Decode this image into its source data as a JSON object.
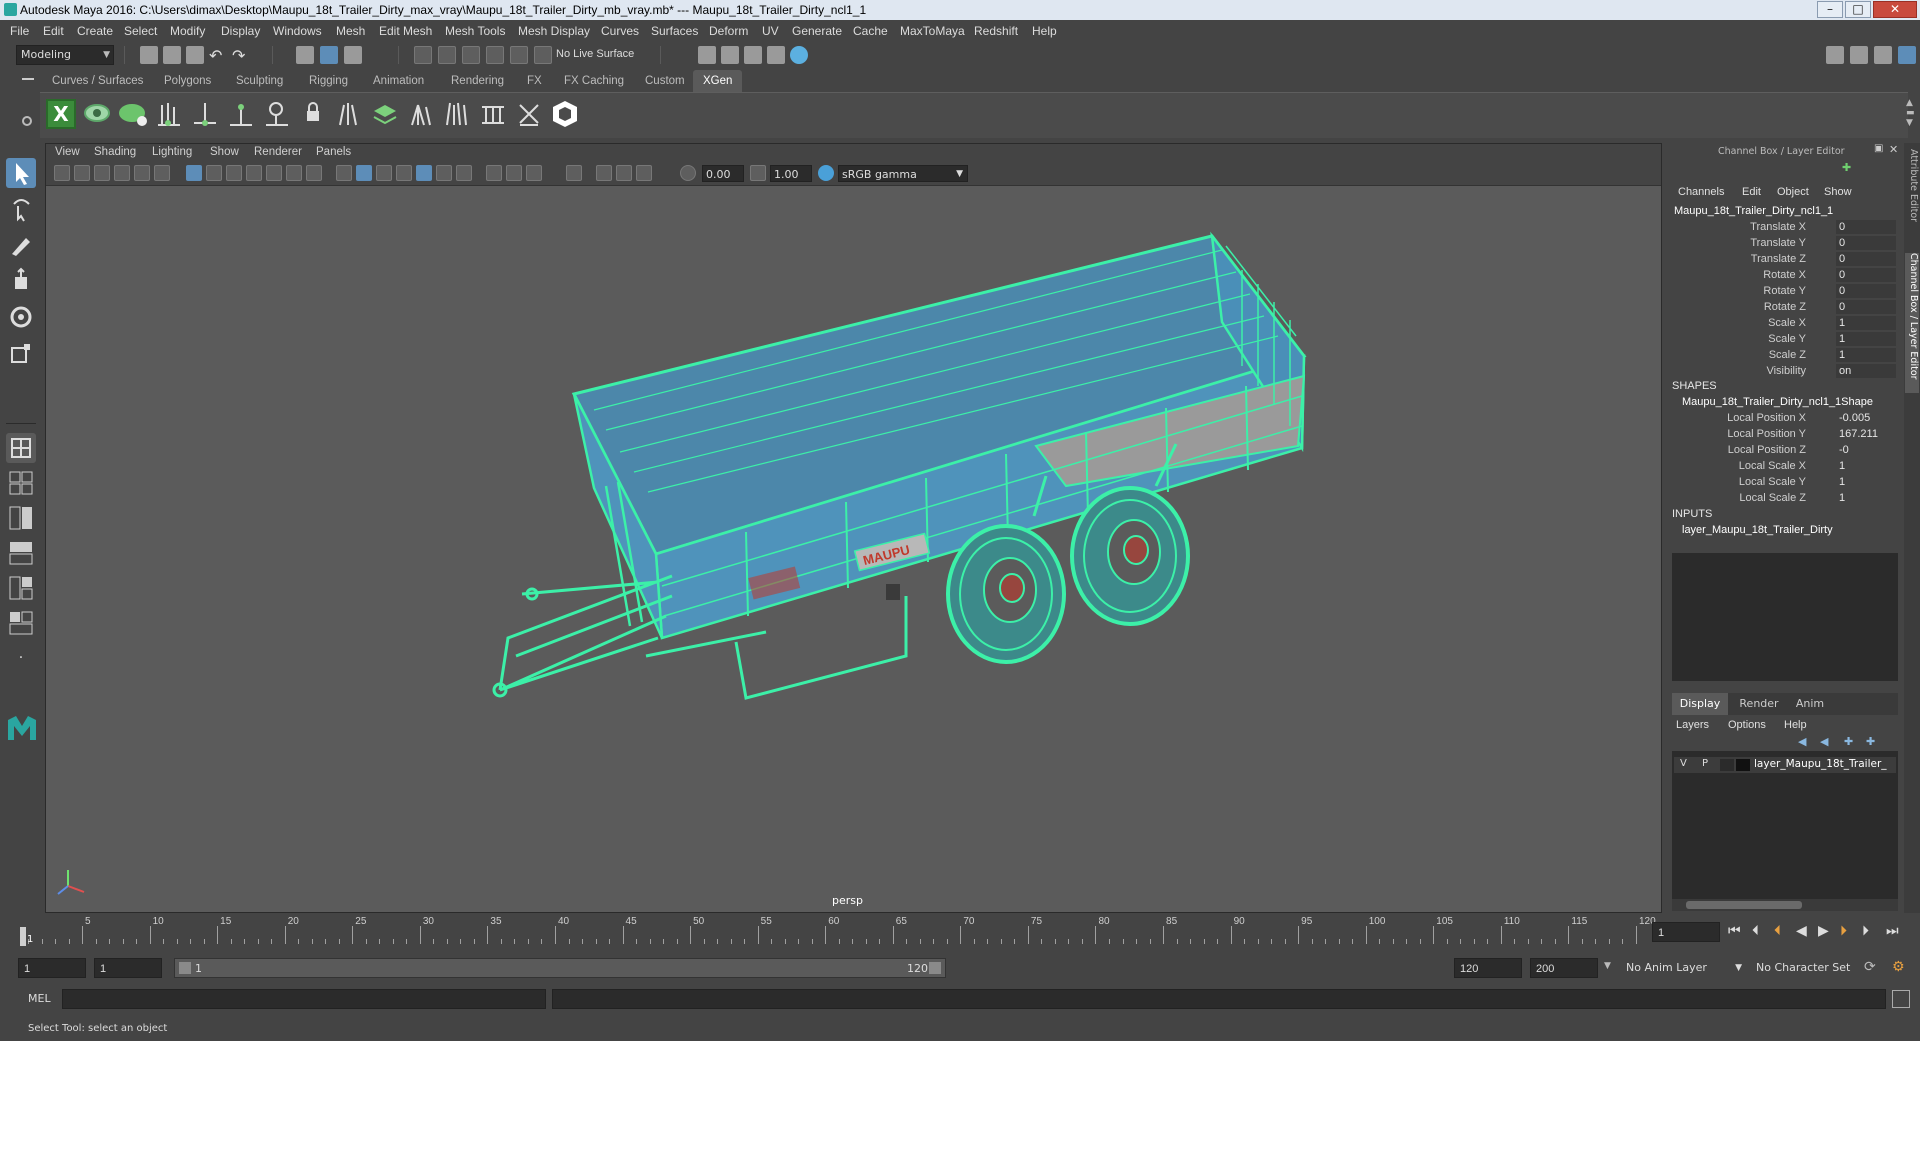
{
  "window": {
    "title": "Autodesk Maya 2016: C:\\Users\\dimax\\Desktop\\Maupu_18t_Trailer_Dirty_max_vray\\Maupu_18t_Trailer_Dirty_mb_vray.mb*   ---   Maupu_18t_Trailer_Dirty_ncl1_1",
    "minimize": "–",
    "maximize": "□",
    "close": "✕"
  },
  "menu": [
    "File",
    "Edit",
    "Create",
    "Select",
    "Modify",
    "Display",
    "Windows",
    "Mesh",
    "Edit Mesh",
    "Mesh Tools",
    "Mesh Display",
    "Curves",
    "Surfaces",
    "Deform",
    "UV",
    "Generate",
    "Cache",
    "MaxToMaya",
    "Redshift",
    "Help"
  ],
  "statusline": {
    "mode": "Modeling",
    "live_surface": "No Live Surface"
  },
  "shelf_tabs": [
    "Curves / Surfaces",
    "Polygons",
    "Sculpting",
    "Rigging",
    "Animation",
    "Rendering",
    "FX",
    "FX Caching",
    "Custom",
    "XGen"
  ],
  "shelf_active": "XGen",
  "viewport": {
    "menu": [
      "View",
      "Shading",
      "Lighting",
      "Show",
      "Renderer",
      "Panels"
    ],
    "exposure": "0.00",
    "gamma": "1.00",
    "color_space": "sRGB gamma",
    "camera": "persp",
    "brand_text": "MAUPU"
  },
  "channel_box": {
    "title": "Channel Box / Layer Editor",
    "menu": [
      "Channels",
      "Edit",
      "Object",
      "Show"
    ],
    "object_name": "Maupu_18t_Trailer_Dirty_ncl1_1",
    "channels": [
      {
        "label": "Translate X",
        "value": "0"
      },
      {
        "label": "Translate Y",
        "value": "0"
      },
      {
        "label": "Translate Z",
        "value": "0"
      },
      {
        "label": "Rotate X",
        "value": "0"
      },
      {
        "label": "Rotate Y",
        "value": "0"
      },
      {
        "label": "Rotate Z",
        "value": "0"
      },
      {
        "label": "Scale X",
        "value": "1"
      },
      {
        "label": "Scale Y",
        "value": "1"
      },
      {
        "label": "Scale Z",
        "value": "1"
      },
      {
        "label": "Visibility",
        "value": "on"
      }
    ],
    "shapes_header": "SHAPES",
    "shape_name": "Maupu_18t_Trailer_Dirty_ncl1_1Shape",
    "shape_channels": [
      {
        "label": "Local Position X",
        "value": "-0.005"
      },
      {
        "label": "Local Position Y",
        "value": "167.211"
      },
      {
        "label": "Local Position Z",
        "value": "-0"
      },
      {
        "label": "Local Scale X",
        "value": "1"
      },
      {
        "label": "Local Scale Y",
        "value": "1"
      },
      {
        "label": "Local Scale Z",
        "value": "1"
      }
    ],
    "inputs_header": "INPUTS",
    "input_name": "layer_Maupu_18t_Trailer_Dirty"
  },
  "layer_editor": {
    "tabs": [
      "Display",
      "Render",
      "Anim"
    ],
    "active_tab": "Display",
    "menu": [
      "Layers",
      "Options",
      "Help"
    ],
    "layer": {
      "v": "V",
      "p": "P",
      "name": "layer_Maupu_18t_Trailer_"
    }
  },
  "side_tabs": [
    "Attribute Editor",
    "Channel Box / Layer Editor"
  ],
  "timeline": {
    "ticks": [
      "5",
      "10",
      "15",
      "20",
      "25",
      "30",
      "35",
      "40",
      "45",
      "50",
      "55",
      "60",
      "65",
      "70",
      "75",
      "80",
      "85",
      "90",
      "95",
      "100",
      "105",
      "110",
      "115",
      "120"
    ],
    "current_frame_marker": "1",
    "current_frame": "1"
  },
  "range": {
    "start": "1",
    "playback_start": "1",
    "slider_start": "1",
    "slider_end": "120",
    "playback_end": "120",
    "end": "200",
    "anim_layer": "No Anim Layer",
    "character_set": "No Character Set"
  },
  "command_line": {
    "label": "MEL"
  },
  "help_line": "Select Tool: select an object",
  "colors": {
    "wire": "#3cf0a8",
    "mesh": "#4a8fb8",
    "viewport_bg": "#5b5b5b",
    "selection_blue": "#5d8db8"
  }
}
